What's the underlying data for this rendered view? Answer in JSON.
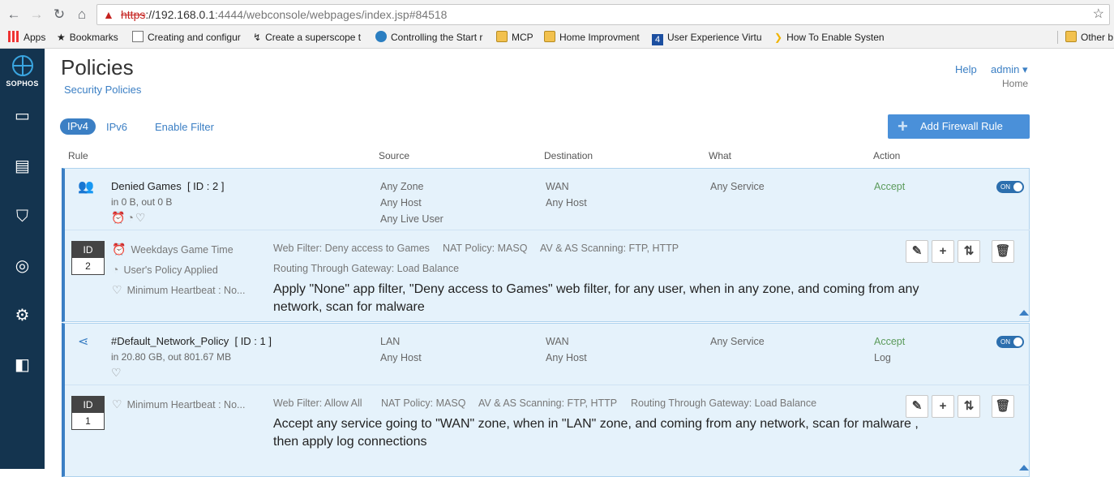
{
  "browser": {
    "url_scheme": "https",
    "url_host": "://192.168.0.1",
    "url_path": ":4444/webconsole/webpages/index.jsp#84518",
    "bookmarks": [
      {
        "label": "Apps",
        "icon": "apps-grid-icon"
      },
      {
        "label": "Bookmarks",
        "icon": "star-icon"
      },
      {
        "label": "Creating and configur",
        "icon": "page-icon"
      },
      {
        "label": "Create a superscope t",
        "icon": "bookmark-icon"
      },
      {
        "label": "Controlling the Start r",
        "icon": "wordpress-icon"
      },
      {
        "label": "MCP",
        "icon": "folder-icon"
      },
      {
        "label": "Home Improvment",
        "icon": "folder-icon"
      },
      {
        "label": "User Experience Virtu",
        "icon": "4-icon"
      },
      {
        "label": "How To Enable Systen",
        "icon": "arrow-icon"
      },
      {
        "label": "Other b",
        "icon": "folder-icon"
      }
    ]
  },
  "brand": {
    "name": "SOPHOS",
    "accent": "#3b7fc4",
    "sidebar_bg": "#14344f"
  },
  "header": {
    "title": "Policies",
    "breadcrumb": "Security Policies",
    "help": "Help",
    "user": "admin ▾",
    "home": "Home"
  },
  "toolbar": {
    "tabs": [
      "IPv4",
      "IPv6"
    ],
    "filter": "Enable Filter",
    "add_button": "Add Firewall Rule"
  },
  "columns": [
    "Rule",
    "Source",
    "Destination",
    "What",
    "Action"
  ],
  "rules": [
    {
      "name": "Denied Games",
      "id_label": "[ ID : 2 ]",
      "traffic": "in 0 B, out 0 B",
      "source": [
        "Any Zone",
        "Any Host",
        "Any Live User"
      ],
      "destination": [
        "WAN",
        "Any Host"
      ],
      "what": "Any Service",
      "action": "Accept",
      "action_extra": "",
      "toggle": "ON",
      "id_header": "ID",
      "id_value": "2",
      "details_left": [
        "Weekdays Game Time",
        "User's Policy Applied",
        "Minimum Heartbeat : No..."
      ],
      "details_mid": [
        "Web Filter: Deny access to Games",
        "NAT Policy: MASQ",
        "AV & AS Scanning: FTP, HTTP",
        "Routing Through Gateway: Load Balance"
      ],
      "summary": "Apply \"None\" app filter, \"Deny access to Games\" web filter, for any user, when in any zone, and coming from any network, scan for malware"
    },
    {
      "name": "#Default_Network_Policy",
      "id_label": "[ ID : 1 ]",
      "traffic": "in 20.80 GB, out 801.67 MB",
      "source": [
        "LAN",
        "Any Host"
      ],
      "destination": [
        "WAN",
        "Any Host"
      ],
      "what": "Any Service",
      "action": "Accept",
      "action_extra": "Log",
      "toggle": "ON",
      "id_header": "ID",
      "id_value": "1",
      "details_left": [
        "Minimum Heartbeat : No..."
      ],
      "details_mid": [
        "Web Filter: Allow All",
        "NAT Policy: MASQ",
        "AV & AS Scanning: FTP, HTTP",
        "Routing Through Gateway: Load Balance"
      ],
      "summary": "Accept any service going to \"WAN\" zone, when in \"LAN\" zone, and coming from any network, scan for malware , then apply log connections"
    }
  ]
}
